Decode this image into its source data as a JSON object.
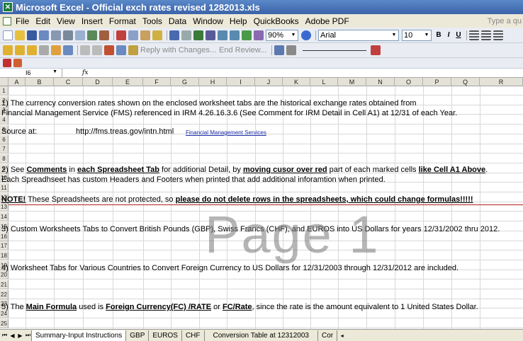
{
  "app": {
    "title": "Microsoft Excel - Official exch rates revised 1282013.xls"
  },
  "menu": {
    "items": [
      "File",
      "Edit",
      "View",
      "Insert",
      "Format",
      "Tools",
      "Data",
      "Window",
      "Help",
      "QuickBooks",
      "Adobe PDF"
    ],
    "ask_placeholder": "Type a qu"
  },
  "toolbar": {
    "zoom": "90%",
    "font_name": "Arial",
    "font_size": "10",
    "bold": "B",
    "italic": "I",
    "underline": "U",
    "reply_with_changes": "Reply with Changes...",
    "end_review": "End Review..."
  },
  "formula_bar": {
    "name_box": "I6",
    "fx": "fx",
    "content": ""
  },
  "columns": [
    "A",
    "B",
    "C",
    "D",
    "E",
    "F",
    "G",
    "H",
    "I",
    "J",
    "K",
    "L",
    "M",
    "N",
    "O",
    "P",
    "Q",
    "R"
  ],
  "rows": [
    "1",
    "2",
    "3",
    "4",
    "5",
    "6",
    "7",
    "8",
    "9",
    "10",
    "11",
    "12",
    "13",
    "14",
    "15",
    "16",
    "17",
    "18",
    "19",
    "20",
    "21",
    "22",
    "23",
    "24",
    "25"
  ],
  "cells": {
    "r2": "1) The currency conversion rates shown on the enclosed worksheet tabs are the historical exchange rates obtained from",
    "r3": "Financial Management Service (FMS) referenced in IRM 4.26.16.3.6 (See Comment for IRM Detail in Cell A1) at 12/31 of each Year.",
    "r5_label": "Source at:",
    "r5_url": "http://fms.treas.gov/intn.html",
    "r5_link": "Financial Management Services",
    "r9": {
      "p1": "2) See ",
      "b1": "Comments",
      "p2": " in ",
      "b2": "each Spreadsheet Tab",
      "p3": " for additional Detail, by ",
      "b3": "moving cusor over red",
      "p4": " part of each marked cells ",
      "b4": "like Cell A1 Above",
      "p5": "."
    },
    "r10": "Each Spreadhseet has custom Headers and Footers when printed that add additional inforamtion when printed.",
    "r12": {
      "b1": "NOTE!",
      "p1": " These Spreadsheets are not protected, so ",
      "b2": "please do not delete rows in the spreadsheets, which could change formulas!!!!!"
    },
    "r15": "3) Custom Worksheets Tabs to Convert British Pounds (GBP), Swiss Francs (CHF), and EUROS into US Dollars for years 12/31/2002 thru 2012.",
    "r19": "4) Worksheet Tabs for Various Countries to Convert Foreign Currency to US Dollars for 12/31/2003 through 12/31/2012 are included.",
    "r23": {
      "p1": "5) The ",
      "b1": "Main Formula",
      "p2": " used is ",
      "b2": "Foreign Currency(FC) /RATE",
      "p3": " or ",
      "b3": "FC/Rate",
      "p4": ", since the rate is the amount equivalent to 1 United States Dollar."
    }
  },
  "watermark": "Page 1",
  "sheet_tabs": [
    "Summary-Input Instructions",
    "GBP",
    "EUROS",
    "CHF",
    "Conversion Table at 12312003",
    "Cor"
  ],
  "colors": {
    "title_bar": "#3b63a8",
    "link": "#1a2aa8",
    "watermark": "#787878"
  },
  "icons": [
    "excel-icon",
    "new-icon",
    "open-icon",
    "save-icon",
    "print-icon",
    "bold-icon",
    "italic-icon",
    "underline-icon",
    "align-left-icon",
    "center-icon"
  ]
}
